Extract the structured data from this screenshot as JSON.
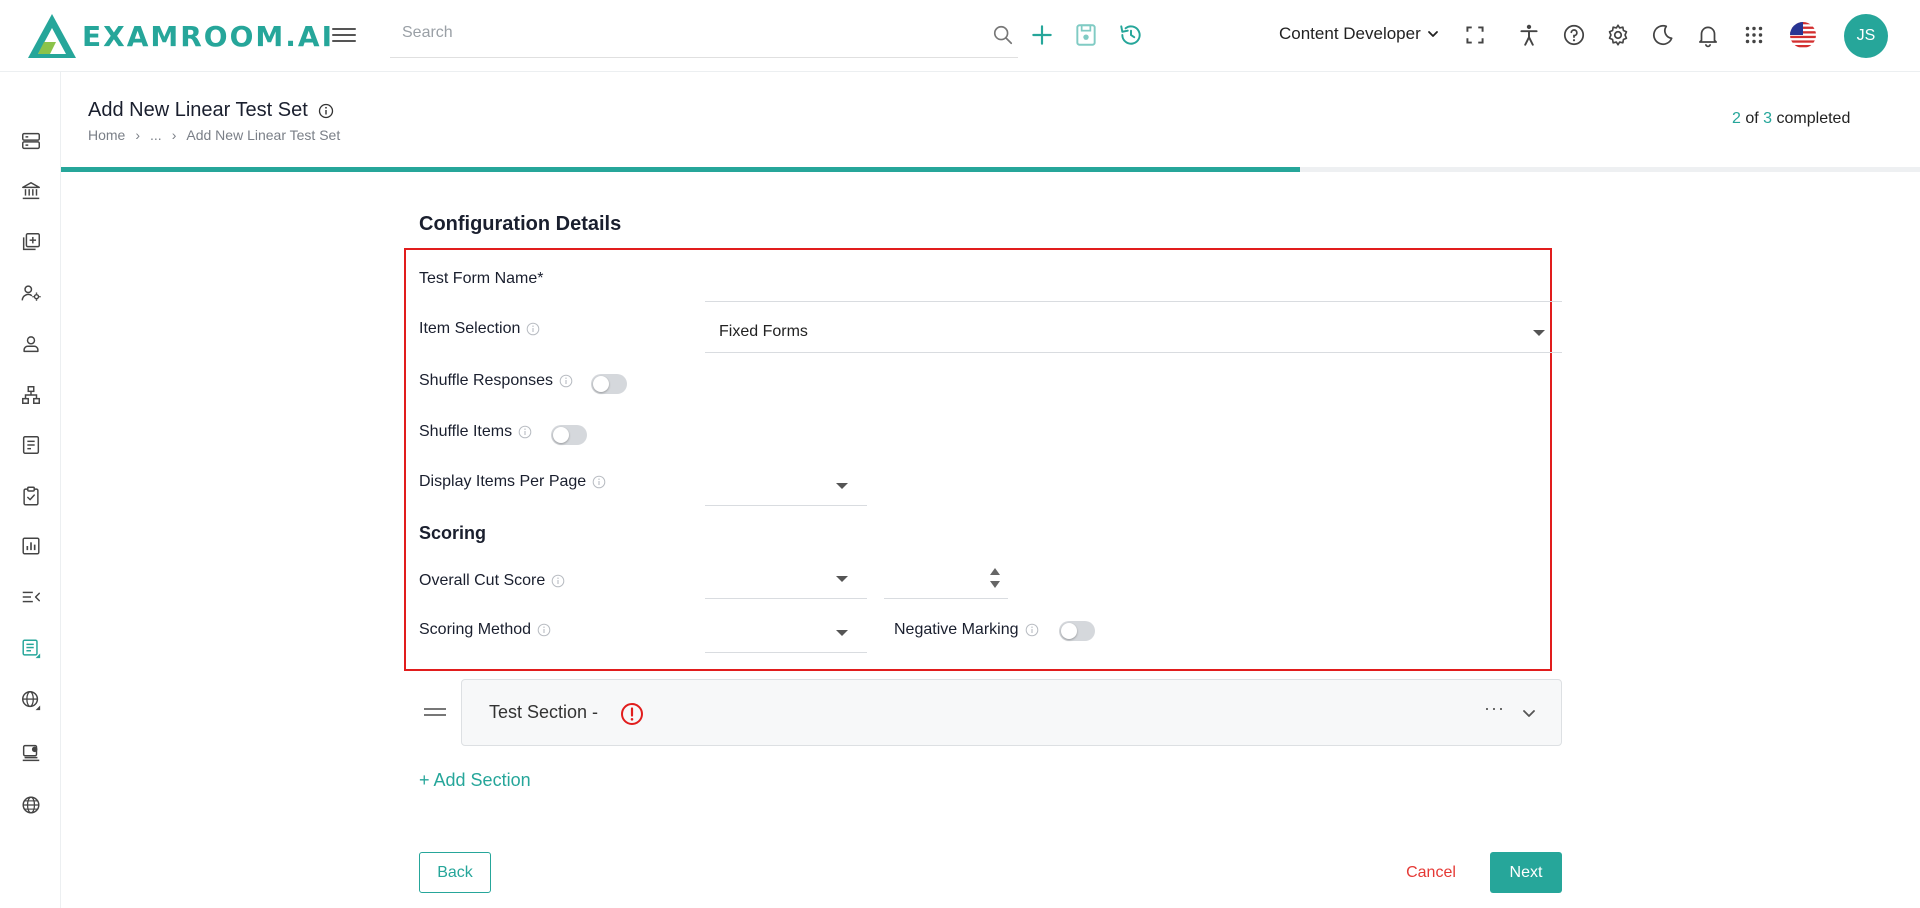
{
  "app": {
    "logo_text": "EXAMROOM.AI"
  },
  "topbar": {
    "search_placeholder": "Search",
    "role_label": "Content Developer",
    "avatar_initials": "JS",
    "icons": [
      "menu-icon",
      "search-icon",
      "add-icon",
      "save-icon",
      "history-icon",
      "expand-icon",
      "accessibility-icon",
      "help-icon",
      "gear-icon",
      "moon-icon",
      "bell-icon",
      "apps-grid-icon",
      "us-flag-icon"
    ]
  },
  "sidebar": {
    "icons": [
      "server-icon",
      "bank-icon",
      "library-add-icon",
      "user-settings-icon",
      "person-icon",
      "hierarchy-icon",
      "document-list-icon",
      "clipboard-check-icon",
      "bar-chart-icon",
      "menu-collapse-icon",
      "test-set-icon",
      "globe-settings-icon",
      "printer-user-icon",
      "globe-icon"
    ],
    "active_index": 10
  },
  "header": {
    "title": "Add New Linear Test Set",
    "breadcrumb": [
      "Home",
      "...",
      "Add New Linear Test Set"
    ],
    "progress": {
      "current": "2",
      "of_label": "of",
      "total": "3",
      "completed_label": "completed",
      "fraction": 0.6667
    }
  },
  "form": {
    "title": "Configuration Details",
    "fields": {
      "test_form_name": {
        "label": "Test Form Name*",
        "value": ""
      },
      "item_selection": {
        "label": "Item Selection",
        "value": "Fixed Forms"
      },
      "shuffle_responses": {
        "label": "Shuffle Responses",
        "on": false
      },
      "shuffle_items": {
        "label": "Shuffle Items",
        "on": false
      },
      "display_items_per_page": {
        "label": "Display Items Per Page",
        "value": ""
      }
    },
    "scoring": {
      "title": "Scoring",
      "overall_cut_score": {
        "label": "Overall Cut Score",
        "type_value": "",
        "number_value": ""
      },
      "scoring_method": {
        "label": "Scoring Method",
        "value": ""
      },
      "negative_marking": {
        "label": "Negative Marking",
        "on": false
      }
    }
  },
  "test_section": {
    "title": "Test Section -",
    "more_label": "···"
  },
  "actions": {
    "add_section": "+ Add Section",
    "back": "Back",
    "cancel": "Cancel",
    "next": "Next"
  },
  "colors": {
    "accent": "#26a69a",
    "danger": "#e11d1d",
    "cancel": "#e53935"
  }
}
